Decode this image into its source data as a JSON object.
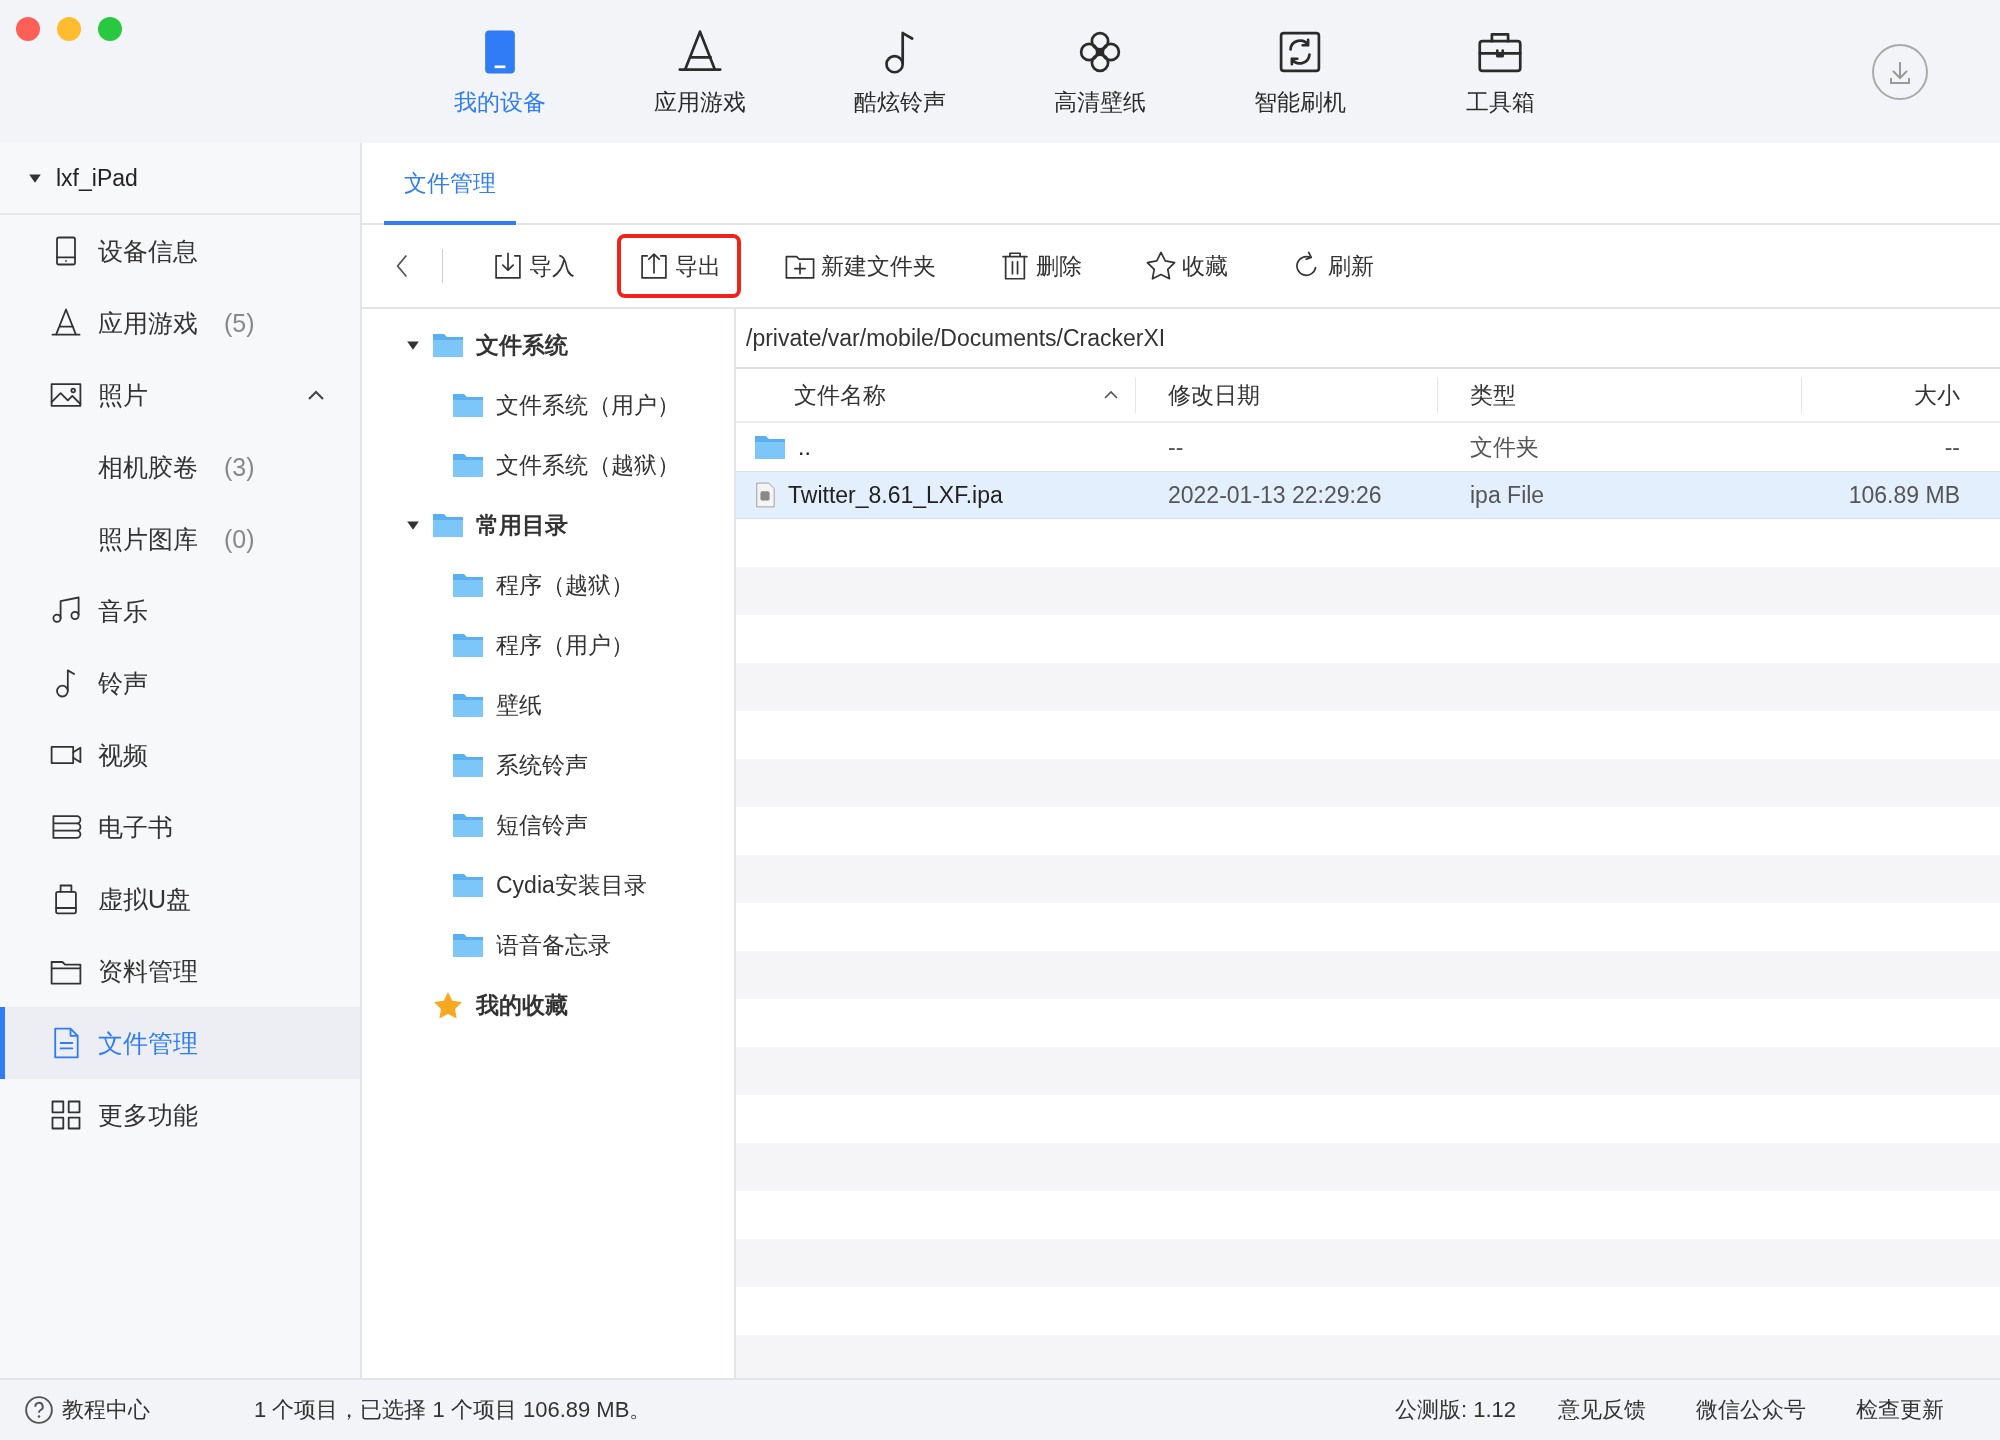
{
  "nav": [
    {
      "label": "我的设备",
      "selected": true
    },
    {
      "label": "应用游戏",
      "selected": false
    },
    {
      "label": "酷炫铃声",
      "selected": false
    },
    {
      "label": "高清壁纸",
      "selected": false
    },
    {
      "label": "智能刷机",
      "selected": false
    },
    {
      "label": "工具箱",
      "selected": false
    }
  ],
  "device": {
    "name": "lxf_iPad",
    "expanded": true
  },
  "sidebar": {
    "items": [
      {
        "label": "设备信息",
        "selected": false
      },
      {
        "label": "应用游戏",
        "count": "(5)",
        "selected": false
      },
      {
        "label": "照片",
        "selected": false,
        "expanded": true,
        "children": [
          {
            "label": "相机胶卷",
            "count": "(3)",
            "selected": false
          },
          {
            "label": "照片图库",
            "count": "(0)",
            "selected": false
          }
        ]
      },
      {
        "label": "音乐",
        "selected": false
      },
      {
        "label": "铃声",
        "selected": false
      },
      {
        "label": "视频",
        "selected": false
      },
      {
        "label": "电子书",
        "selected": false
      },
      {
        "label": "虚拟U盘",
        "selected": false
      },
      {
        "label": "资料管理",
        "selected": false
      },
      {
        "label": "文件管理",
        "selected": true
      },
      {
        "label": "更多功能",
        "selected": false
      }
    ]
  },
  "tabs": [
    {
      "label": "文件管理",
      "selected": true
    }
  ],
  "toolbar": {
    "buttons": [
      {
        "label": "导入",
        "highlighted": false
      },
      {
        "label": "导出",
        "highlighted": true
      },
      {
        "label": "新建文件夹",
        "highlighted": false
      },
      {
        "label": "删除",
        "highlighted": false
      },
      {
        "label": "收藏",
        "highlighted": false
      },
      {
        "label": "刷新",
        "highlighted": false
      }
    ]
  },
  "tree": [
    {
      "label": "文件系统",
      "kind": "group",
      "expanded": true,
      "children": [
        {
          "label": "文件系统（用户）"
        },
        {
          "label": "文件系统（越狱）"
        }
      ]
    },
    {
      "label": "常用目录",
      "kind": "group",
      "expanded": true,
      "children": [
        {
          "label": "程序（越狱）"
        },
        {
          "label": "程序（用户）"
        },
        {
          "label": "壁纸"
        },
        {
          "label": "系统铃声"
        },
        {
          "label": "短信铃声"
        },
        {
          "label": "Cydia安装目录"
        },
        {
          "label": "语音备忘录"
        }
      ]
    },
    {
      "label": "我的收藏",
      "kind": "favorites"
    }
  ],
  "path": "/private/var/mobile/Documents/CrackerXI",
  "table": {
    "columns": [
      {
        "label": "文件名称",
        "sorted": true
      },
      {
        "label": "修改日期",
        "sorted": false
      },
      {
        "label": "类型",
        "sorted": false
      },
      {
        "label": "大小",
        "sorted": false
      }
    ],
    "rows": [
      {
        "kind": "folder",
        "name": "..",
        "date": "--",
        "type": "文件夹",
        "size": "--",
        "selected": false
      },
      {
        "kind": "file",
        "name": "Twitter_8.61_LXF.ipa",
        "date": "2022-01-13 22:29:26",
        "type": "ipa File",
        "size": "106.89 MB",
        "selected": true
      }
    ]
  },
  "status_bar": {
    "help": "教程中心",
    "summary": "1 个项目，已选择 1 个项目 106.89 MB。",
    "version": "公测版: 1.12",
    "links": [
      "意见反馈",
      "微信公众号",
      "检查更新"
    ]
  }
}
